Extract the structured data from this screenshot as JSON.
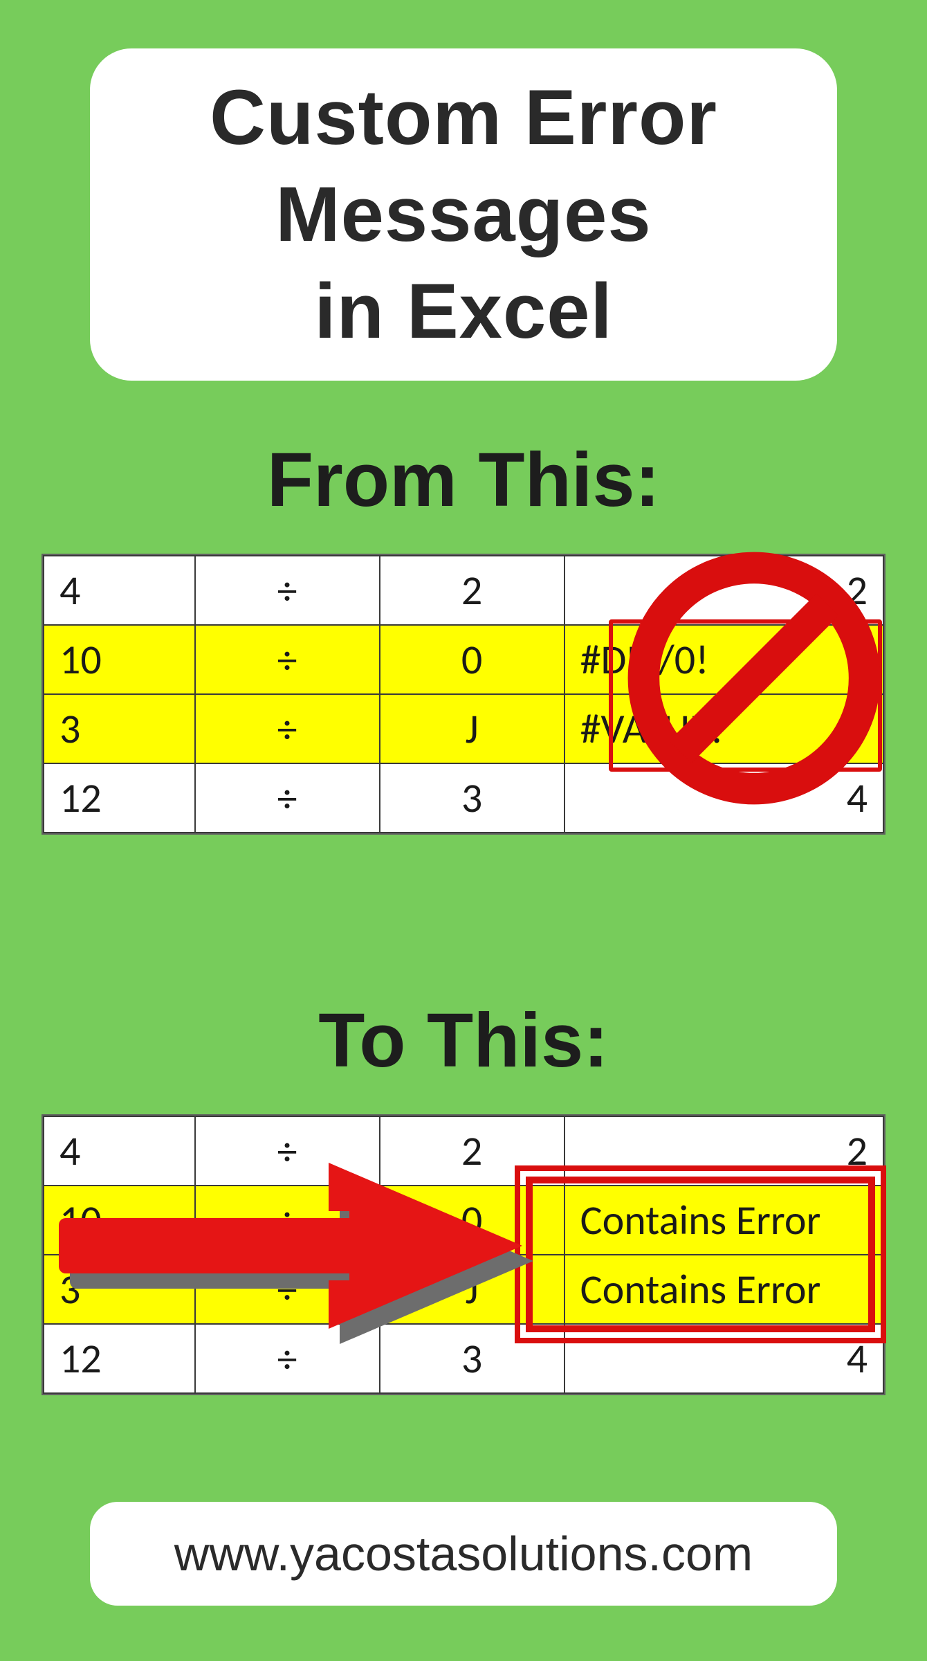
{
  "title": "Custom Error\nMessages\nin Excel",
  "labels": {
    "from": "From This:",
    "to": "To This:"
  },
  "from_table": {
    "rows": [
      {
        "a": "4",
        "b": "÷",
        "c": "2",
        "d": "2",
        "hl": false,
        "err": false
      },
      {
        "a": "10",
        "b": "÷",
        "c": "0",
        "d": "#DIV/0!",
        "hl": true,
        "err": true
      },
      {
        "a": "3",
        "b": "÷",
        "c": "J",
        "d": "#VALUE!",
        "hl": true,
        "err": true
      },
      {
        "a": "12",
        "b": "÷",
        "c": "3",
        "d": "4",
        "hl": false,
        "err": false
      }
    ]
  },
  "to_table": {
    "rows": [
      {
        "a": "4",
        "b": "÷",
        "c": "2",
        "d": "2",
        "hl": false,
        "err": false
      },
      {
        "a": "10",
        "b": "÷",
        "c": "0",
        "d": "Contains Error",
        "hl": true,
        "err": true
      },
      {
        "a": "3",
        "b": "÷",
        "c": "J",
        "d": "Contains Error",
        "hl": true,
        "err": true
      },
      {
        "a": "12",
        "b": "÷",
        "c": "3",
        "d": "4",
        "hl": false,
        "err": false
      }
    ]
  },
  "footer_url": "www.yacostasolutions.com",
  "colors": {
    "bg": "#77cc5b",
    "highlight": "#ffff00",
    "accent_red": "#d90e0e",
    "text": "#2a2a2a"
  }
}
